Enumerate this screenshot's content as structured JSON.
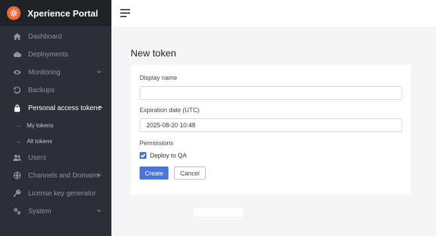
{
  "app": {
    "title": "Xperience Portal",
    "logo_icon": "brand-logo-icon",
    "accent": "#f0643c"
  },
  "sidebar": {
    "items": [
      {
        "label": "Dashboard",
        "icon": "home-icon"
      },
      {
        "label": "Deployments",
        "icon": "cloud-upload-icon"
      },
      {
        "label": "Monitoring",
        "icon": "eye-icon",
        "expandable": true
      },
      {
        "label": "Backups",
        "icon": "history-icon"
      },
      {
        "label": "Personal access tokens",
        "icon": "lock-icon",
        "expandable": true,
        "expanded": true
      },
      {
        "label": "Users",
        "icon": "users-icon"
      },
      {
        "label": "Channels and Domains",
        "icon": "globe-icon",
        "expandable": true
      },
      {
        "label": "License key generator",
        "icon": "key-icon"
      },
      {
        "label": "System",
        "icon": "cogs-icon",
        "expandable": true
      }
    ],
    "subitems": [
      {
        "label": "My tokens"
      },
      {
        "label": "All tokens"
      }
    ]
  },
  "main": {
    "title": "New token",
    "form": {
      "display_name_label": "Display name",
      "display_name_value": "",
      "expiration_label": "Expiration date (UTC)",
      "expiration_value": "2025-08-20 10:48",
      "permissions_label": "Permissions",
      "permission_option": "Deploy to QA",
      "permission_checked": true,
      "create_label": "Create",
      "cancel_label": "Cancel"
    }
  },
  "colors": {
    "sidebar_bg": "#2c2f36",
    "primary": "#4a74d6",
    "main_bg": "#f4f5f7"
  }
}
